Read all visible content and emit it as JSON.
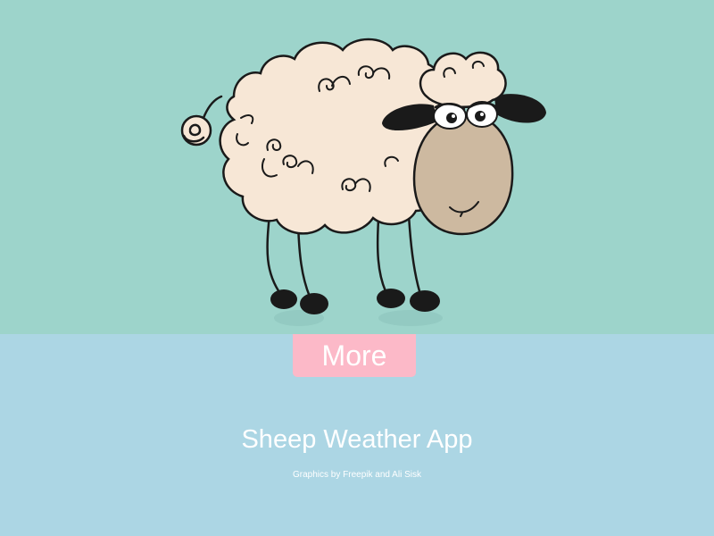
{
  "colors": {
    "hero_background": "#9dd4cb",
    "lower_background": "#acd6e4",
    "button_background": "#fcb9c8",
    "text": "#ffffff",
    "wool": "#f7e7d6",
    "face": "#cdb9a0",
    "ears_and_hooves": "#1a1a1a"
  },
  "illustration": {
    "icon": "sheep-icon"
  },
  "more_button": {
    "label": "More"
  },
  "title": "Sheep Weather App",
  "credits": "Graphics by Freepik and Ali Sisk"
}
